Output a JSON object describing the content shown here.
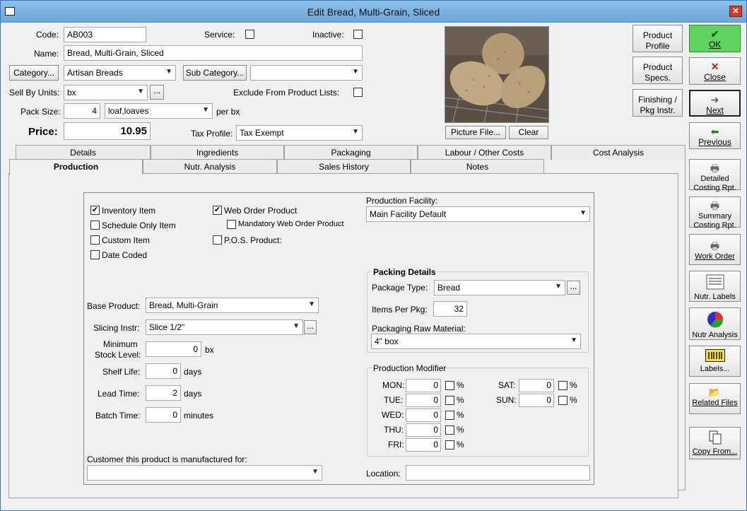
{
  "window": {
    "title": "Edit Bread, Multi-Grain, Sliced"
  },
  "header": {
    "code_label": "Code:",
    "code_value": "AB003",
    "service_label": "Service:",
    "inactive_label": "Inactive:",
    "name_label": "Name:",
    "name_value": "Bread, Multi-Grain, Sliced",
    "category_button": "Category...",
    "category_value": "Artisan Breads",
    "subcategory_button": "Sub Category...",
    "subcategory_value": "",
    "sell_by_label": "Sell By Units:",
    "sell_by_value": "bx",
    "ellipsis": "...",
    "exclude_label": "Exclude From Product Lists:",
    "pack_size_label": "Pack Size:",
    "pack_size_value": "4",
    "pack_unit_value": "loaf,loaves",
    "per_label": "per bx",
    "price_label": "Price:",
    "price_value": "10.95",
    "tax_label": "Tax Profile:",
    "tax_value": "Tax Exempt",
    "picture_button": "Picture File...",
    "clear_button": "Clear"
  },
  "upper_buttons": {
    "product_profile": "Product Profile",
    "product_specs": "Product Specs.",
    "finishing": "Finishing / Pkg Instr."
  },
  "right_buttons": [
    {
      "label": "OK",
      "icon": "check-icon"
    },
    {
      "label": "Close",
      "icon": "x-icon"
    },
    {
      "label": "Next",
      "icon": "next-icon"
    },
    {
      "label": "Previous",
      "icon": "previous-icon"
    },
    {
      "label": "Detailed Costing Rpt.",
      "icon": "printer-icon"
    },
    {
      "label": "Summary Costing Rpt.",
      "icon": "printer-icon"
    },
    {
      "label": "Work Order",
      "icon": "printer-icon"
    },
    {
      "label": "Nutr. Labels",
      "icon": "label-sheet-icon"
    },
    {
      "label": "Nutr Analysis",
      "icon": "pie-chart-icon"
    },
    {
      "label": "Labels...",
      "icon": "barcode-icon"
    },
    {
      "label": "Related Files",
      "icon": "folder-icon"
    },
    {
      "label": "Copy From...",
      "icon": "copy-icon"
    }
  ],
  "tabs_row1": [
    "Details",
    "Ingredients",
    "Packaging",
    "Labour / Other Costs",
    "Cost Analysis"
  ],
  "tabs_row2": [
    "Production",
    "Nutr. Analysis",
    "Sales History",
    "Notes"
  ],
  "production": {
    "inventory_item": "Inventory Item",
    "schedule_only": "Schedule Only Item",
    "custom_item": "Custom Item",
    "date_coded": "Date Coded",
    "web_order": "Web Order Product",
    "mandatory_web": "Mandatory Web Order Product",
    "pos_product": "P.O.S. Product:",
    "facility_label": "Production Facility:",
    "facility_value": "Main Facility Default",
    "base_product_label": "Base Product:",
    "base_product_value": "Bread, Multi-Grain",
    "slicing_label": "Slicing Instr:",
    "slicing_value": "Slice 1/2\"",
    "min_stock_label_1": "Minimum",
    "min_stock_label_2": "Stock Level:",
    "min_stock_value": "0",
    "min_stock_unit": "bx",
    "shelf_life_label": "Shelf Life:",
    "shelf_life_value": "0",
    "shelf_life_unit": "days",
    "lead_time_label": "Lead Time:",
    "lead_time_value": "2",
    "lead_time_unit": "days",
    "batch_time_label": "Batch Time:",
    "batch_time_value": "0",
    "batch_time_unit": "minutes",
    "customer_label": "Customer this product is manufactured for:",
    "customer_value": "",
    "packing_title": "Packing Details",
    "package_type_label": "Package Type:",
    "package_type_value": "Bread",
    "items_per_pkg_label": "Items Per Pkg:",
    "items_per_pkg_value": "32",
    "pkg_raw_label": "Packaging Raw Material:",
    "pkg_raw_value": "4\" box",
    "modifier_title": "Production Modifier",
    "modifier_left": [
      {
        "day": "MON:",
        "value": "0"
      },
      {
        "day": "TUE:",
        "value": "0"
      },
      {
        "day": "WED:",
        "value": "0"
      },
      {
        "day": "THU:",
        "value": "0"
      },
      {
        "day": "FRI:",
        "value": "0"
      }
    ],
    "modifier_right": [
      {
        "day": "SAT:",
        "value": "0"
      },
      {
        "day": "SUN:",
        "value": "0"
      }
    ],
    "percent": "%",
    "location_label": "Location:",
    "location_value": ""
  },
  "colors": {
    "ok_green": "#5fd35f",
    "title_blue": "#7fb6e4"
  }
}
